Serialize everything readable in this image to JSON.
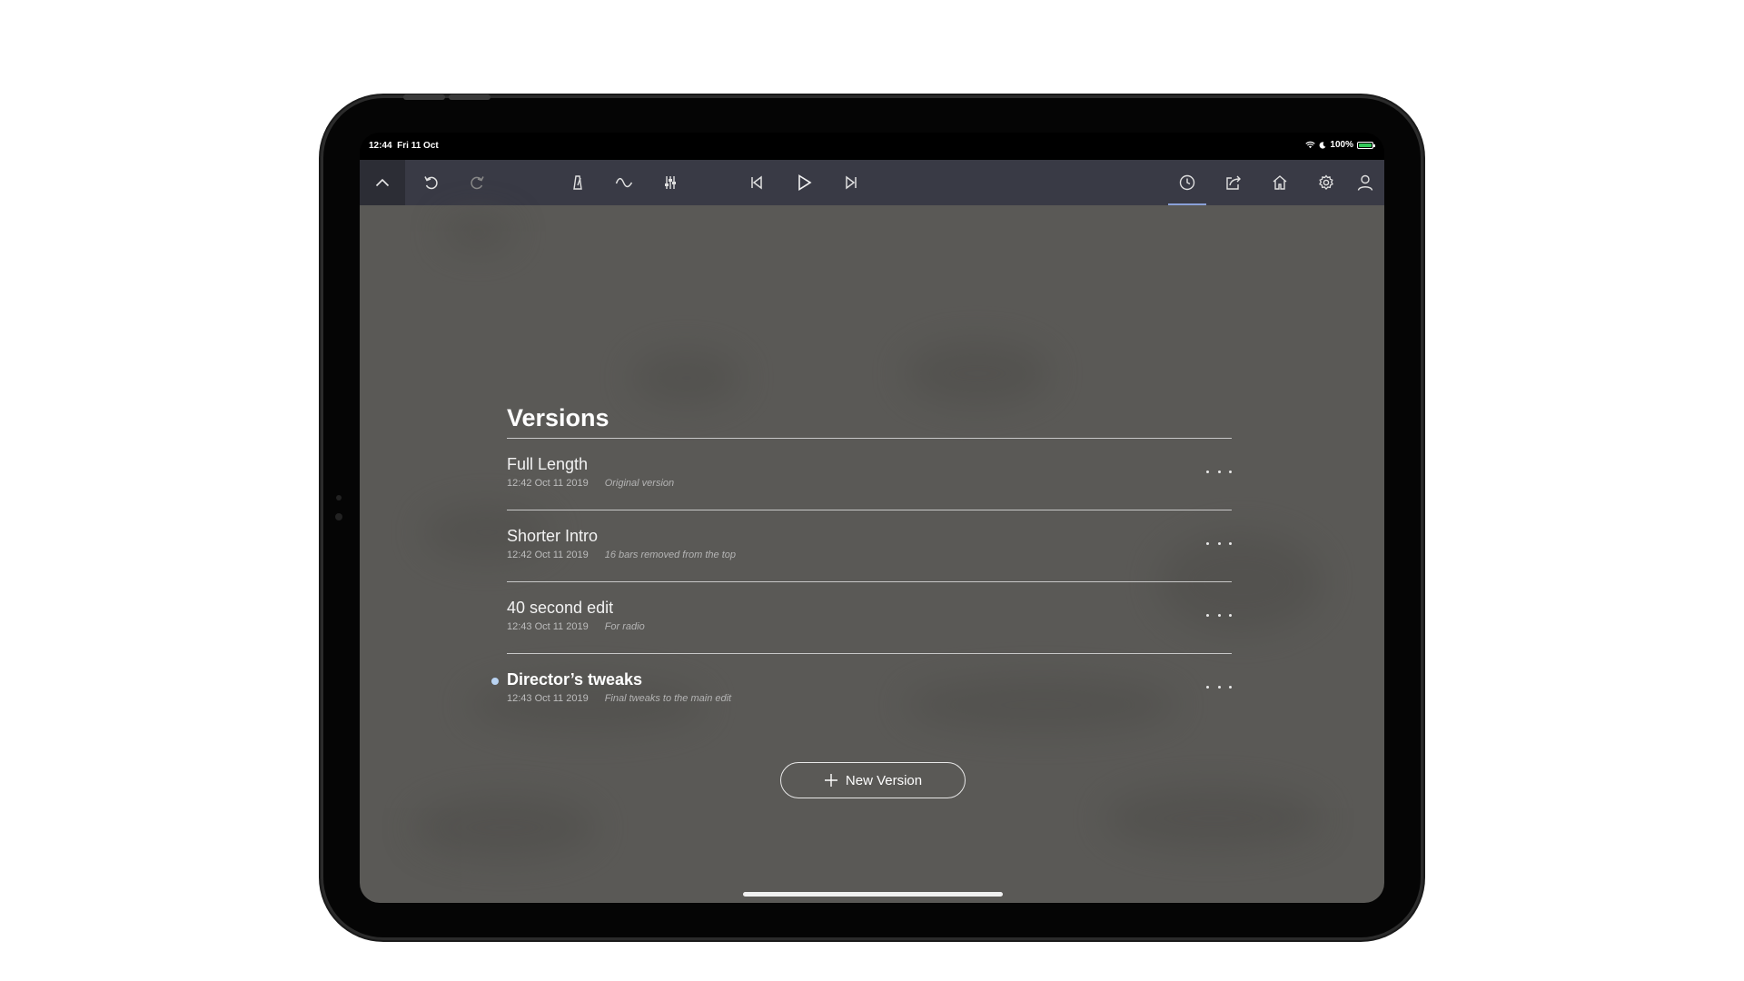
{
  "status_bar": {
    "time": "12:44",
    "date": "Fri 11 Oct",
    "battery": "100%"
  },
  "toolbar": {
    "left": [
      "chevron-up-icon",
      "undo-icon",
      "redo-icon"
    ],
    "center": [
      "metronome-icon",
      "curve-icon",
      "mixer-icon",
      "skip-back-icon",
      "play-icon",
      "skip-forward-icon"
    ],
    "right": [
      "history-icon",
      "share-icon",
      "home-icon",
      "settings-icon",
      "account-icon"
    ],
    "active": "history-icon"
  },
  "versions": {
    "title": "Versions",
    "items": [
      {
        "name": "Full Length",
        "timestamp": "12:42 Oct 11 2019",
        "note": "Original version",
        "current": false
      },
      {
        "name": "Shorter Intro",
        "timestamp": "12:42 Oct 11 2019",
        "note": "16 bars removed from the top",
        "current": false
      },
      {
        "name": "40 second edit",
        "timestamp": "12:43 Oct 11 2019",
        "note": "For radio",
        "current": false
      },
      {
        "name": "Director’s tweaks",
        "timestamp": "12:43 Oct 11 2019",
        "note": "Final tweaks to the main edit",
        "current": true
      }
    ],
    "new_button_label": "New Version"
  },
  "colors": {
    "toolbar_bg": "#393a45",
    "content_bg": "#5a5956",
    "accent": "#8aa0d8",
    "current_dot": "#b9d3f2"
  }
}
